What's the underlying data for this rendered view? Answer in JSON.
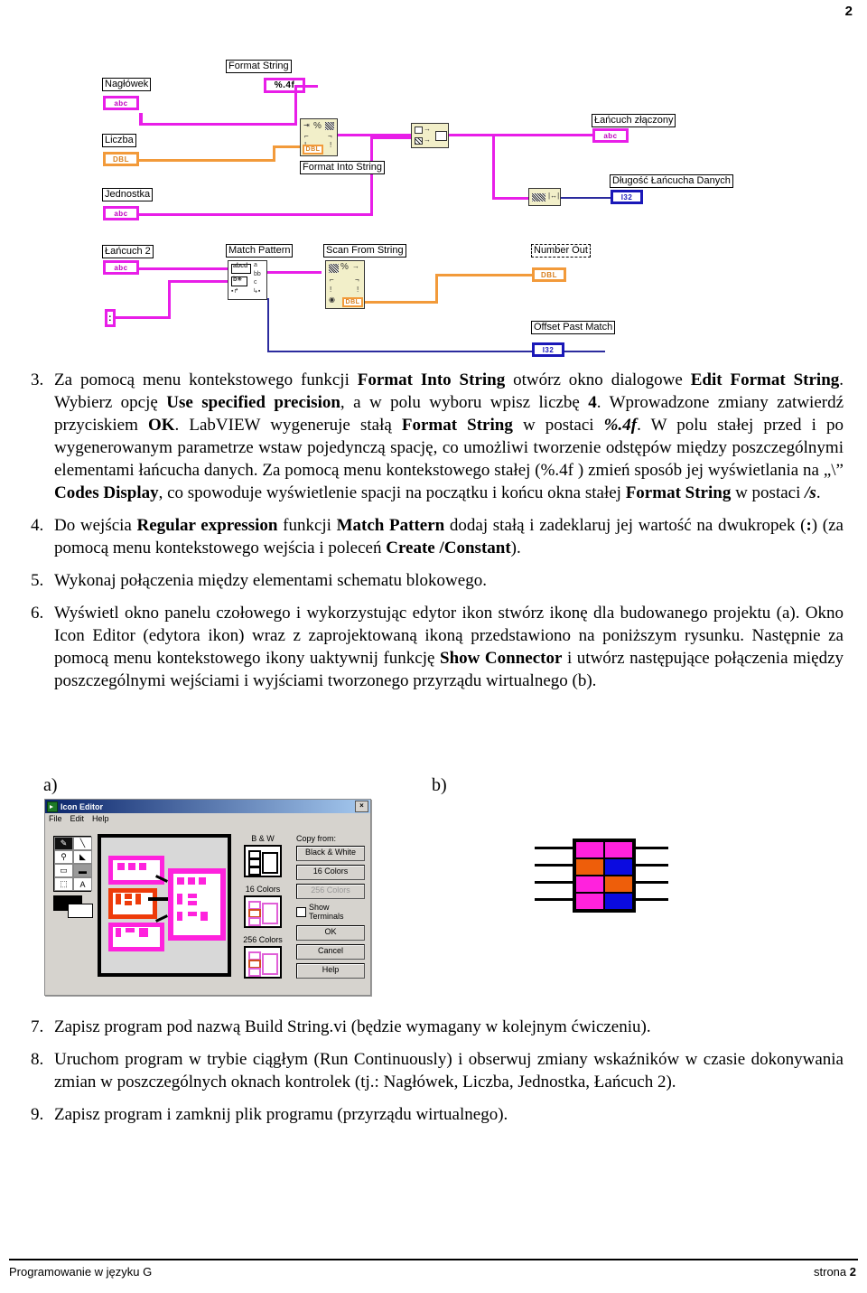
{
  "header": {
    "page_number": "2"
  },
  "block_diagram": {
    "title": "LabVIEW block diagram Build String.vi",
    "labels": {
      "naglowek": "Nagłówek",
      "format_string": "Format String",
      "format_string_const": "%.4f",
      "liczba": "Liczba",
      "format_into_string": "Format Into String",
      "jednostka": "Jednostka",
      "lancuch_zlaczony": "Łańcuch złączony",
      "dlugosc": "Długość Łańcucha Danych",
      "lancuch2": "Łańcuch 2",
      "match_pattern": "Match Pattern",
      "scan_from_string": "Scan From String",
      "number_out": "Number Out",
      "offset_past_match": "Offset Past Match",
      "colon_constant": ":"
    },
    "terminal_types": {
      "abc": "abc",
      "dbl": "DBL",
      "i32": "I32"
    },
    "colors": {
      "string_wire": "#e81ee8",
      "double_wire": "#f29a3a",
      "integer_wire": "#2b2b9e",
      "node_fill": "#f2efc9"
    }
  },
  "instructions": [
    {
      "number": "3.",
      "html": "Za pomocą menu kontekstowego funkcji <b>Format Into String</b> otwórz okno dialogowe <b>Edit Format String</b>. Wybierz opcję <b>Use specified precision</b>, a w polu wyboru wpisz liczbę <b>4</b>. Wprowadzone zmiany zatwierdź przyciskiem <b>OK</b>. LabVIEW wygeneruje stałą <b>Format String</b> w postaci <i>%.4f</i>. W polu stałej przed i po wygenerowanym parametrze wstaw pojedynczą spację, co umożliwi tworzenie odstępów między poszczególnymi elementami łańcucha danych. Za pomocą menu kontekstowego stałej (%.4f ) zmień sposób jej wyświetlania na „\\&rdquo; <b>Codes Display</b>, co spowoduje wyświetlenie spacji na początku i końcu okna stałej <b>Format String</b> w postaci <i>/s</i>."
    },
    {
      "number": "4.",
      "html": "Do wejścia <b>Regular expression</b> funkcji <b>Match Pattern</b> dodaj stałą i zadeklaruj jej wartość na dwukropek (<b>:</b>) (za pomocą menu kontekstowego wejścia i poleceń <b>Create /Constant</b>)."
    },
    {
      "number": "5.",
      "html": "Wykonaj połączenia między elementami schematu blokowego."
    },
    {
      "number": "6.",
      "html": "Wyświetl okno panelu czołowego i wykorzystując edytor ikon stwórz ikonę dla budowanego projektu (a). Okno Icon Editor (edytora ikon) wraz z zaprojektowaną ikoną przedstawiono na poniższym rysunku. Następnie za pomocą menu kontekstowego ikony uaktywnij funkcję <b>Show Connector</b> i utwórz następujące połączenia między poszczególnymi wejściami i wyjściami tworzonego przyrządu wirtualnego (b)."
    }
  ],
  "instructions_after": [
    {
      "number": "7.",
      "html": "Zapisz program pod nazwą Build String.vi (będzie wymagany w kolejnym ćwiczeniu)."
    },
    {
      "number": "8.",
      "html": "Uruchom program w trybie ciągłym (Run Continuously) i obserwuj zmiany wskaźników w czasie dokonywania zmian w poszczególnych oknach kontrolek (tj.: Nagłówek, Liczba, Jednostka, Łańcuch 2)."
    },
    {
      "number": "9.",
      "html": "Zapisz program i zamknij plik programu (przyrządu wirtualnego)."
    }
  ],
  "figures": {
    "a_label": "a)",
    "b_label": "b)"
  },
  "icon_editor": {
    "title": "Icon Editor",
    "close_label": "×",
    "menu": [
      "File",
      "Edit",
      "Help"
    ],
    "tools": [
      "pencil-tool",
      "line-tool",
      "eyedropper-tool",
      "fill-tool",
      "rectangle-tool",
      "filled-rectangle-tool",
      "select-tool",
      "text-tool"
    ],
    "color_modes": [
      {
        "label": "B & W"
      },
      {
        "label": "16 Colors"
      },
      {
        "label": "256 Colors"
      }
    ],
    "copy_from_label": "Copy from:",
    "copy_buttons": [
      {
        "label": "Black & White",
        "disabled": false
      },
      {
        "label": "16 Colors",
        "disabled": false
      },
      {
        "label": "256 Colors",
        "disabled": true
      }
    ],
    "show_terminals_label": "Show Terminals",
    "show_terminals_checked": false,
    "action_buttons": [
      {
        "label": "OK"
      },
      {
        "label": "Cancel"
      },
      {
        "label": "Help"
      }
    ]
  },
  "connector_pane": {
    "rows": 4,
    "cols": 2,
    "cells": [
      [
        "#ff22dd",
        "#ff22dd"
      ],
      [
        "#ee5e0a",
        "#0b0be0"
      ],
      [
        "#ff22dd",
        "#ee5e0a"
      ],
      [
        "#ff22dd",
        "#0b0be0"
      ]
    ]
  },
  "footer": {
    "left": "Programowanie w języku G",
    "right_label": "strona",
    "right_number": "2"
  }
}
